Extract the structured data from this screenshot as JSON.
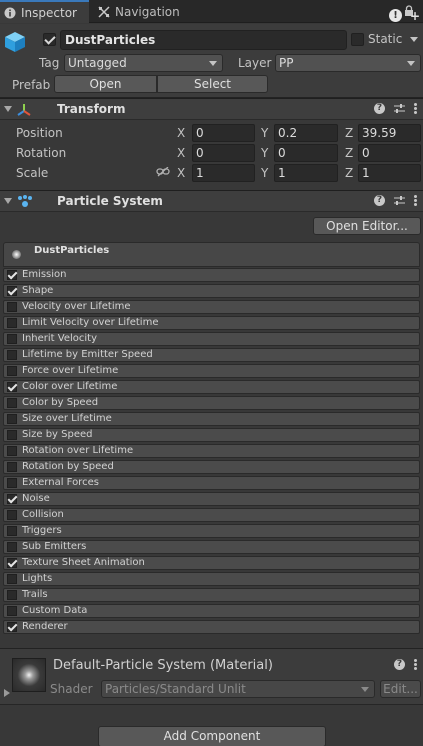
{
  "tabs": [
    {
      "label": "Inspector",
      "icon": "info-icon",
      "active": true
    },
    {
      "label": "Navigation",
      "icon": "navigation-icon",
      "active": false
    }
  ],
  "header": {
    "active": true,
    "name": "DustParticles",
    "static_label": "Static",
    "static_checked": false,
    "tag_label": "Tag",
    "tag_value": "Untagged",
    "layer_label": "Layer",
    "layer_value": "PP",
    "prefab_label": "Prefab",
    "prefab_open": "Open",
    "prefab_select": "Select"
  },
  "transform": {
    "title": "Transform",
    "rows": [
      {
        "label": "Position",
        "x": "0",
        "y": "0.2",
        "z": "39.59"
      },
      {
        "label": "Rotation",
        "x": "0",
        "y": "0",
        "z": "0"
      },
      {
        "label": "Scale",
        "x": "1",
        "y": "1",
        "z": "1"
      }
    ],
    "axis": {
      "x": "X",
      "y": "Y",
      "z": "Z"
    }
  },
  "particle_system": {
    "title": "Particle System",
    "open_editor": "Open Editor...",
    "system_name": "DustParticles",
    "modules": [
      {
        "label": "Emission",
        "on": true
      },
      {
        "label": "Shape",
        "on": true
      },
      {
        "label": "Velocity over Lifetime",
        "on": false
      },
      {
        "label": "Limit Velocity over Lifetime",
        "on": false
      },
      {
        "label": "Inherit Velocity",
        "on": false
      },
      {
        "label": "Lifetime by Emitter Speed",
        "on": false
      },
      {
        "label": "Force over Lifetime",
        "on": false
      },
      {
        "label": "Color over Lifetime",
        "on": true
      },
      {
        "label": "Color by Speed",
        "on": false
      },
      {
        "label": "Size over Lifetime",
        "on": false
      },
      {
        "label": "Size by Speed",
        "on": false
      },
      {
        "label": "Rotation over Lifetime",
        "on": false
      },
      {
        "label": "Rotation by Speed",
        "on": false
      },
      {
        "label": "External Forces",
        "on": false
      },
      {
        "label": "Noise",
        "on": true
      },
      {
        "label": "Collision",
        "on": false
      },
      {
        "label": "Triggers",
        "on": false
      },
      {
        "label": "Sub Emitters",
        "on": false
      },
      {
        "label": "Texture Sheet Animation",
        "on": true
      },
      {
        "label": "Lights",
        "on": false
      },
      {
        "label": "Trails",
        "on": false
      },
      {
        "label": "Custom Data",
        "on": false
      },
      {
        "label": "Renderer",
        "on": true
      }
    ]
  },
  "material": {
    "title": "Default-Particle System (Material)",
    "shader_label": "Shader",
    "shader_value": "Particles/Standard Unlit",
    "edit_label": "Edit..."
  },
  "add_component": "Add Component",
  "colors": {
    "background": "#383838",
    "accent": "#3a79bb",
    "field": "#2a2a2a"
  }
}
